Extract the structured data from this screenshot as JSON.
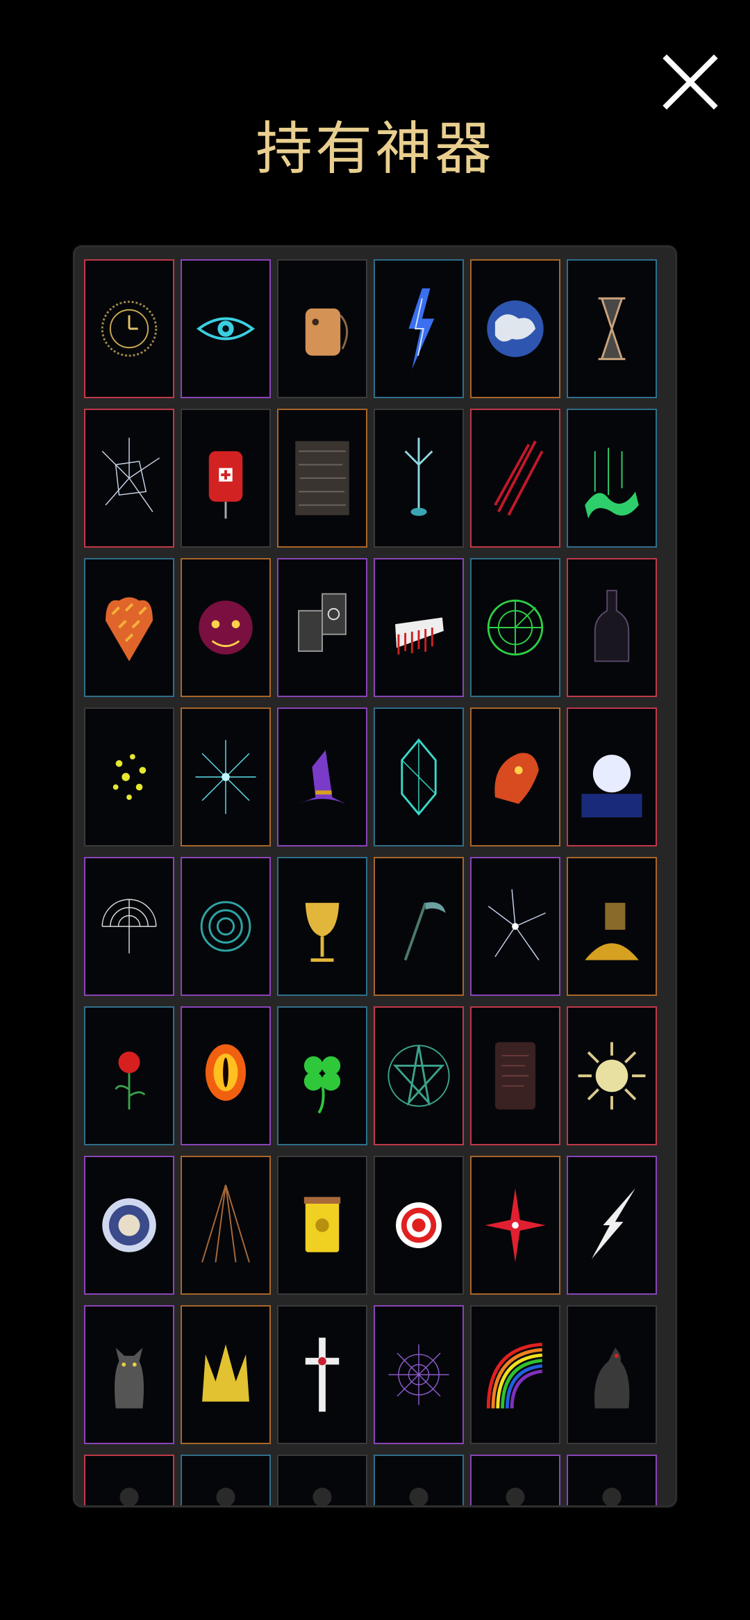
{
  "header": {
    "title": "持有神器",
    "close_icon": "close-icon"
  },
  "colors": {
    "title": "#e9cf8f",
    "frame_red": "#c0394a",
    "frame_purple": "#8a44b8",
    "frame_blue": "#2f6f8a",
    "frame_orange": "#a8662a",
    "frame_dark": "#3a3a3a"
  },
  "artifacts": [
    {
      "icon": "golden-clock-icon",
      "frame": "#c0394a"
    },
    {
      "icon": "cyan-eye-icon",
      "frame": "#8a44b8"
    },
    {
      "icon": "cat-backpack-icon",
      "frame": "#3a3a3a"
    },
    {
      "icon": "blue-lightning-icon",
      "frame": "#2f6f8a"
    },
    {
      "icon": "earth-globe-icon",
      "frame": "#a8662a"
    },
    {
      "icon": "hourglass-icon",
      "frame": "#2f6f8a"
    },
    {
      "icon": "cracked-glass-icon",
      "frame": "#c0394a"
    },
    {
      "icon": "blood-bag-icon",
      "frame": "#3a3a3a"
    },
    {
      "icon": "static-noise-icon",
      "frame": "#a8662a"
    },
    {
      "icon": "radio-tower-icon",
      "frame": "#3a3a3a"
    },
    {
      "icon": "red-slash-icon",
      "frame": "#c0394a"
    },
    {
      "icon": "aurora-icon",
      "frame": "#2f6f8a"
    },
    {
      "icon": "fire-scales-icon",
      "frame": "#2f6f8a"
    },
    {
      "icon": "jester-mask-icon",
      "frame": "#a8662a"
    },
    {
      "icon": "tarot-cards-icon",
      "frame": "#8a44b8"
    },
    {
      "icon": "broken-comb-icon",
      "frame": "#8a44b8"
    },
    {
      "icon": "green-radar-icon",
      "frame": "#2f6f8a"
    },
    {
      "icon": "dark-bottle-icon",
      "frame": "#c0394a"
    },
    {
      "icon": "yellow-spores-icon",
      "frame": "#3a3a3a"
    },
    {
      "icon": "cyan-starburst-icon",
      "frame": "#a8662a"
    },
    {
      "icon": "witch-hat-icon",
      "frame": "#8a44b8"
    },
    {
      "icon": "crystal-gem-icon",
      "frame": "#2f6f8a"
    },
    {
      "icon": "dragon-head-icon",
      "frame": "#a8662a"
    },
    {
      "icon": "full-moon-icon",
      "frame": "#c0394a"
    },
    {
      "icon": "spiral-web-icon",
      "frame": "#8a44b8"
    },
    {
      "icon": "teal-vortex-icon",
      "frame": "#8a44b8"
    },
    {
      "icon": "golden-chalice-icon",
      "frame": "#2f6f8a"
    },
    {
      "icon": "scythe-icon",
      "frame": "#a8662a"
    },
    {
      "icon": "shattered-star-icon",
      "frame": "#8a44b8"
    },
    {
      "icon": "gold-hoard-icon",
      "frame": "#a8662a"
    },
    {
      "icon": "red-rose-icon",
      "frame": "#2f6f8a"
    },
    {
      "icon": "fire-eye-icon",
      "frame": "#8a44b8"
    },
    {
      "icon": "four-leaf-clover-icon",
      "frame": "#2f6f8a"
    },
    {
      "icon": "pentagram-icon",
      "frame": "#c0394a"
    },
    {
      "icon": "stone-tablet-icon",
      "frame": "#c0394a"
    },
    {
      "icon": "sun-face-icon",
      "frame": "#c0394a"
    },
    {
      "icon": "medallion-face-icon",
      "frame": "#8a44b8"
    },
    {
      "icon": "tower-spire-icon",
      "frame": "#a8662a"
    },
    {
      "icon": "amber-jar-icon",
      "frame": "#3a3a3a"
    },
    {
      "icon": "bullseye-target-icon",
      "frame": "#3a3a3a"
    },
    {
      "icon": "red-compass-star-icon",
      "frame": "#a8662a"
    },
    {
      "icon": "white-lightning-icon",
      "frame": "#8a44b8"
    },
    {
      "icon": "black-cat-icon",
      "frame": "#8a44b8"
    },
    {
      "icon": "golden-crown-icon",
      "frame": "#a8662a"
    },
    {
      "icon": "holy-cross-icon",
      "frame": "#3a3a3a"
    },
    {
      "icon": "spider-web-icon",
      "frame": "#8a44b8"
    },
    {
      "icon": "rainbow-icon",
      "frame": "#3a3a3a"
    },
    {
      "icon": "raven-icon",
      "frame": "#3a3a3a"
    },
    {
      "icon": "partial-artifact-icon",
      "frame": "#c0394a"
    },
    {
      "icon": "partial-artifact-icon",
      "frame": "#2f6f8a"
    },
    {
      "icon": "partial-artifact-icon",
      "frame": "#3a3a3a"
    },
    {
      "icon": "partial-artifact-icon",
      "frame": "#2f6f8a"
    },
    {
      "icon": "partial-artifact-icon",
      "frame": "#8a44b8"
    },
    {
      "icon": "partial-artifact-icon",
      "frame": "#8a44b8"
    }
  ]
}
